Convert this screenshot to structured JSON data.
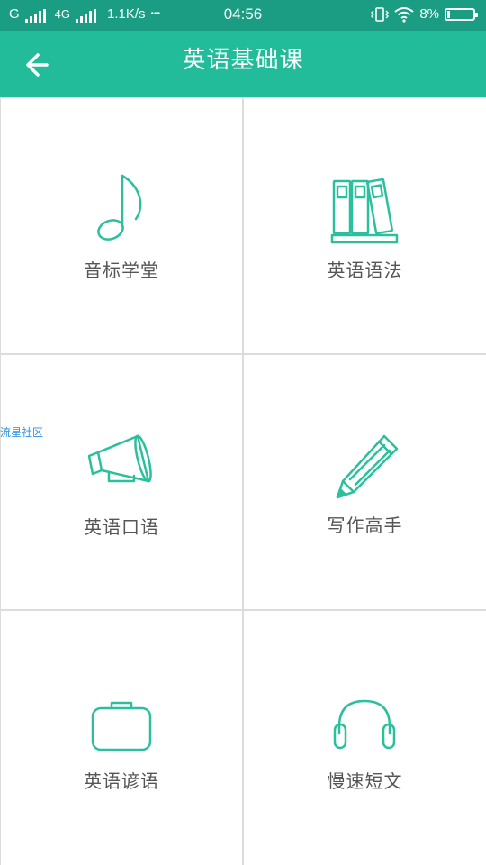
{
  "status_bar": {
    "carrier_label": "G",
    "network_label": "4G",
    "speed": "1.1K/s",
    "more_dots": "•••",
    "time": "04:56",
    "battery": "8%"
  },
  "header": {
    "title": "英语基础课"
  },
  "tiles": [
    {
      "label": "音标学堂",
      "icon": "music-note-icon"
    },
    {
      "label": "英语语法",
      "icon": "books-icon"
    },
    {
      "label": "英语口语",
      "icon": "megaphone-icon"
    },
    {
      "label": "写作高手",
      "icon": "pencil-icon"
    },
    {
      "label": "英语谚语",
      "icon": "briefcase-icon"
    },
    {
      "label": "慢速短文",
      "icon": "headphones-icon"
    }
  ],
  "watermark": "流星社区",
  "colors": {
    "accent": "#23bc9b",
    "status_bar": "#1b9d83",
    "icon_stroke": "#2cbf9e",
    "label_text": "#555555",
    "divider": "#dcdcdc"
  }
}
